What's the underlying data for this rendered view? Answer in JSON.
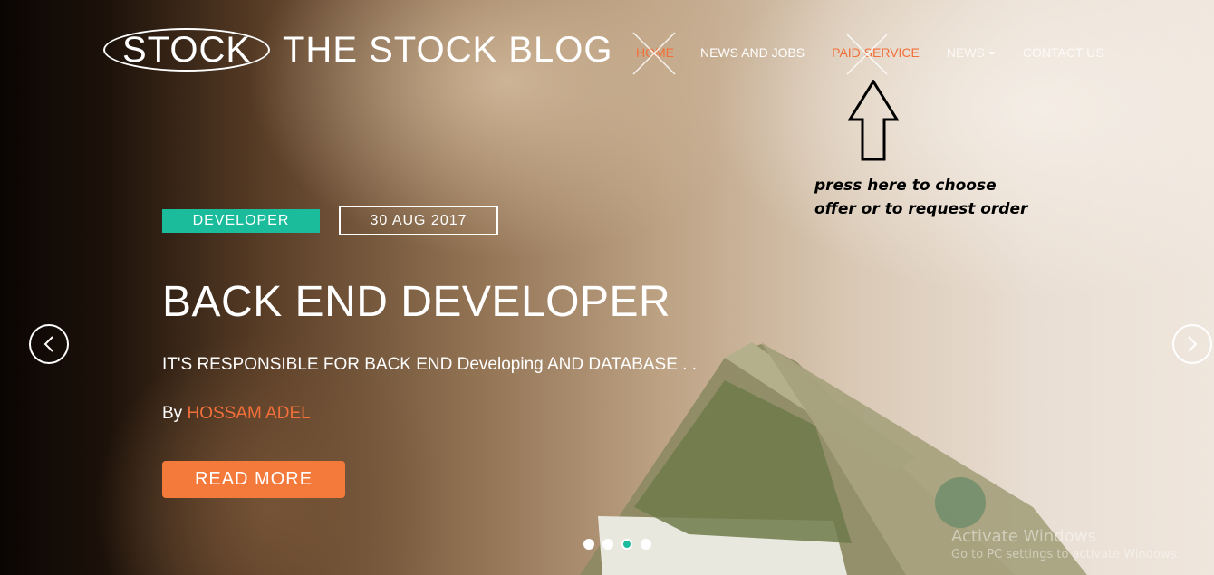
{
  "brand": {
    "logo_text": "STOCK",
    "title": "THE STOCK BLOG"
  },
  "nav": {
    "items": [
      {
        "label": "HOME",
        "state": "active"
      },
      {
        "label": "NEWS AND JOBS"
      },
      {
        "label": "PAID SERVICE"
      },
      {
        "label": "NEWS",
        "has_dropdown": true
      },
      {
        "label": "CONTACT US"
      }
    ]
  },
  "annotation": {
    "line1": "press here to choose",
    "line2": "offer or to request order"
  },
  "slide": {
    "tag": "DEVELOPER",
    "date": "30 AUG 2017",
    "title": "BACK END DEVELOPER",
    "description": "IT'S RESPONSIBLE FOR BACK END Developing AND DATABASE . .",
    "by_label": "By",
    "author": "HOSSAM ADEL",
    "cta": "READ MORE"
  },
  "carousel": {
    "slide_count": 4,
    "active_index": 2
  },
  "watermark": {
    "title": "Activate Windows",
    "subtitle": "Go to PC settings to activate Windows."
  },
  "colors": {
    "accent_orange": "#f36f3a",
    "tag_teal": "#1abc9c",
    "button_orange": "#f47a3c"
  }
}
